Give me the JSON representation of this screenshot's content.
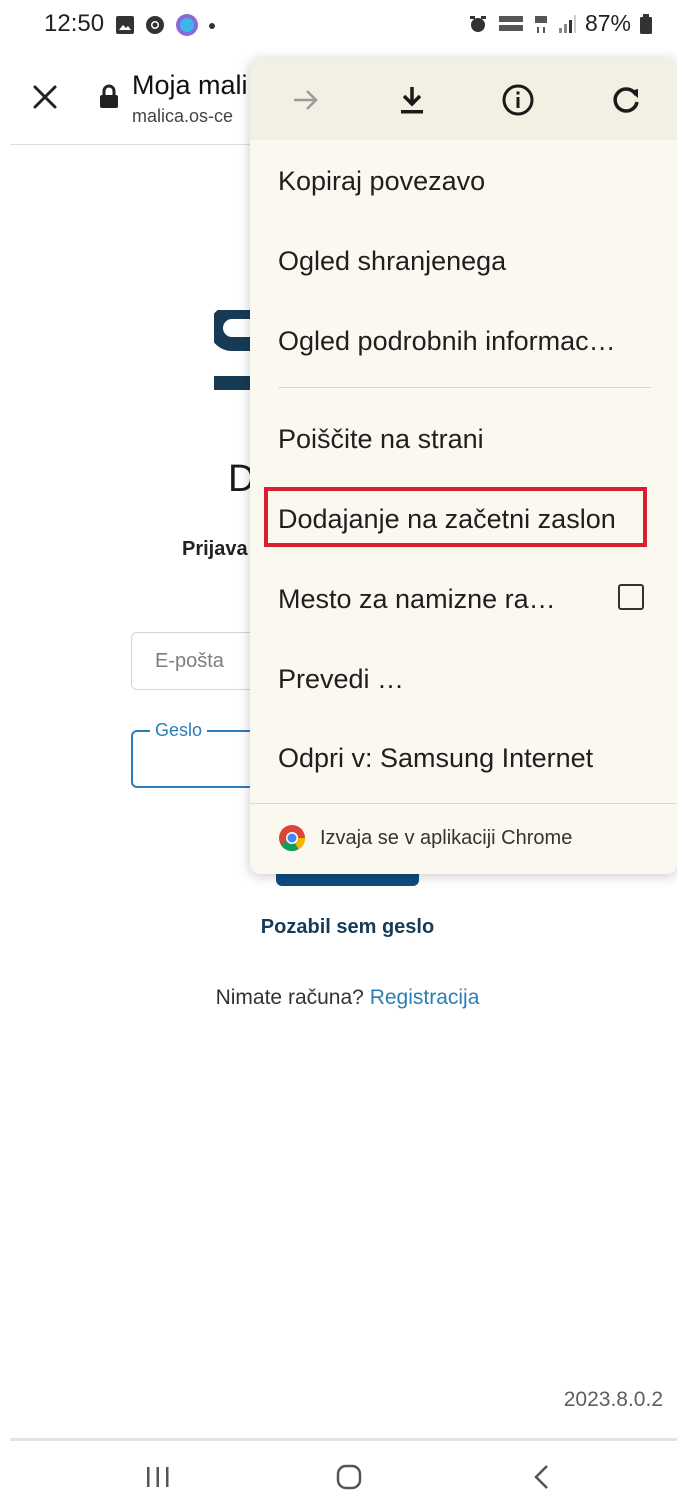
{
  "status_bar": {
    "time": "12:50",
    "battery": "87%"
  },
  "toolbar": {
    "title": "Moja mali",
    "url": "malica.os-ce"
  },
  "page": {
    "heading_fragment": "D",
    "subtitle_fragment": "Prijava",
    "email_placeholder": "E-pošta",
    "password_label": "Geslo",
    "forgot_password": "Pozabil sem geslo",
    "no_account": "Nimate računa?",
    "register_link": "Registracija",
    "version": "2023.8.0.2"
  },
  "menu": {
    "icons": [
      "forward-icon",
      "download-icon",
      "info-icon",
      "refresh-icon"
    ],
    "items": [
      "Kopiraj povezavo",
      "Ogled shranjenega",
      "Ogled podrobnih informac…",
      "Poiščite na strani",
      "Dodajanje na začetni zaslon",
      "Mesto za namizne ra…",
      "Prevedi …",
      "Odpri v: Samsung Internet"
    ],
    "desktop_site_checked": false,
    "footer": "Izvaja se v aplikaciji Chrome"
  },
  "colors": {
    "highlight": "#d8202e",
    "menu_bg": "#fbf8ef",
    "link": "#2b7fb4",
    "brand_dark": "#0e4d80"
  }
}
